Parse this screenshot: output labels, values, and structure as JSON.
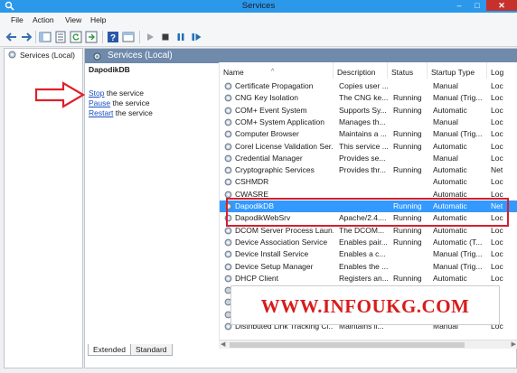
{
  "window": {
    "title": "Services"
  },
  "menu": [
    "File",
    "Action",
    "View",
    "Help"
  ],
  "tree": {
    "root_label": "Services (Local)"
  },
  "panel": {
    "header": "Services (Local)",
    "selected_service": "DapodikDB",
    "actions": [
      {
        "link": "Stop",
        "rest": " the service"
      },
      {
        "link": "Pause",
        "rest": " the service"
      },
      {
        "link": "Restart",
        "rest": " the service"
      }
    ]
  },
  "columns": [
    "Name",
    "Description",
    "Status",
    "Startup Type",
    "Log"
  ],
  "services": [
    {
      "name": "Certificate Propagation",
      "desc": "Copies user ...",
      "status": "",
      "startup": "Manual",
      "log": "Loc"
    },
    {
      "name": "CNG Key Isolation",
      "desc": "The CNG ke...",
      "status": "Running",
      "startup": "Manual (Trig...",
      "log": "Loc"
    },
    {
      "name": "COM+ Event System",
      "desc": "Supports Sy...",
      "status": "Running",
      "startup": "Automatic",
      "log": "Loc"
    },
    {
      "name": "COM+ System Application",
      "desc": "Manages th...",
      "status": "",
      "startup": "Manual",
      "log": "Loc"
    },
    {
      "name": "Computer Browser",
      "desc": "Maintains a ...",
      "status": "Running",
      "startup": "Manual (Trig...",
      "log": "Loc"
    },
    {
      "name": "Corel License Validation Ser...",
      "desc": "This service ...",
      "status": "Running",
      "startup": "Automatic",
      "log": "Loc"
    },
    {
      "name": "Credential Manager",
      "desc": "Provides se...",
      "status": "",
      "startup": "Manual",
      "log": "Loc"
    },
    {
      "name": "Cryptographic Services",
      "desc": "Provides thr...",
      "status": "Running",
      "startup": "Automatic",
      "log": "Net"
    },
    {
      "name": "CSHMDR",
      "desc": "",
      "status": "",
      "startup": "Automatic",
      "log": "Loc"
    },
    {
      "name": "CWASRE",
      "desc": "",
      "status": "",
      "startup": "Automatic",
      "log": "Loc"
    },
    {
      "name": "DapodikDB",
      "desc": "",
      "status": "Running",
      "startup": "Automatic",
      "log": "Net"
    },
    {
      "name": "DapodikWebSrv",
      "desc": "Apache/2.4....",
      "status": "Running",
      "startup": "Automatic",
      "log": "Loc"
    },
    {
      "name": "DCOM Server Process Laun...",
      "desc": "The DCOM...",
      "status": "Running",
      "startup": "Automatic",
      "log": "Loc"
    },
    {
      "name": "Device Association Service",
      "desc": "Enables pair...",
      "status": "Running",
      "startup": "Automatic (T...",
      "log": "Loc"
    },
    {
      "name": "Device Install Service",
      "desc": "Enables a c...",
      "status": "",
      "startup": "Manual (Trig...",
      "log": "Loc"
    },
    {
      "name": "Device Setup Manager",
      "desc": "Enables the ...",
      "status": "",
      "startup": "Manual (Trig...",
      "log": "Loc"
    },
    {
      "name": "DHCP Client",
      "desc": "Registers an...",
      "status": "Running",
      "startup": "Automatic",
      "log": "Loc"
    },
    {
      "name": "",
      "desc": "",
      "status": "",
      "startup": "",
      "log": ""
    },
    {
      "name": "",
      "desc": "",
      "status": "",
      "startup": "",
      "log": ""
    },
    {
      "name": "",
      "desc": "",
      "status": "",
      "startup": "",
      "log": ""
    },
    {
      "name": "Distributed Link Tracking Cl...",
      "desc": "Maintains li...",
      "status": "",
      "startup": "Manual",
      "log": "Loc"
    }
  ],
  "selected_index": 10,
  "watermark": "WWW.INFOUKG.COM",
  "tabs": [
    "Extended",
    "Standard"
  ],
  "colors": {
    "titlebar": "#2b98ea",
    "header": "#6f8aab",
    "selection": "#3399ff",
    "highlight_box": "#d4202e",
    "watermark_text": "#d81c1c",
    "arrow": "#e0202a"
  }
}
